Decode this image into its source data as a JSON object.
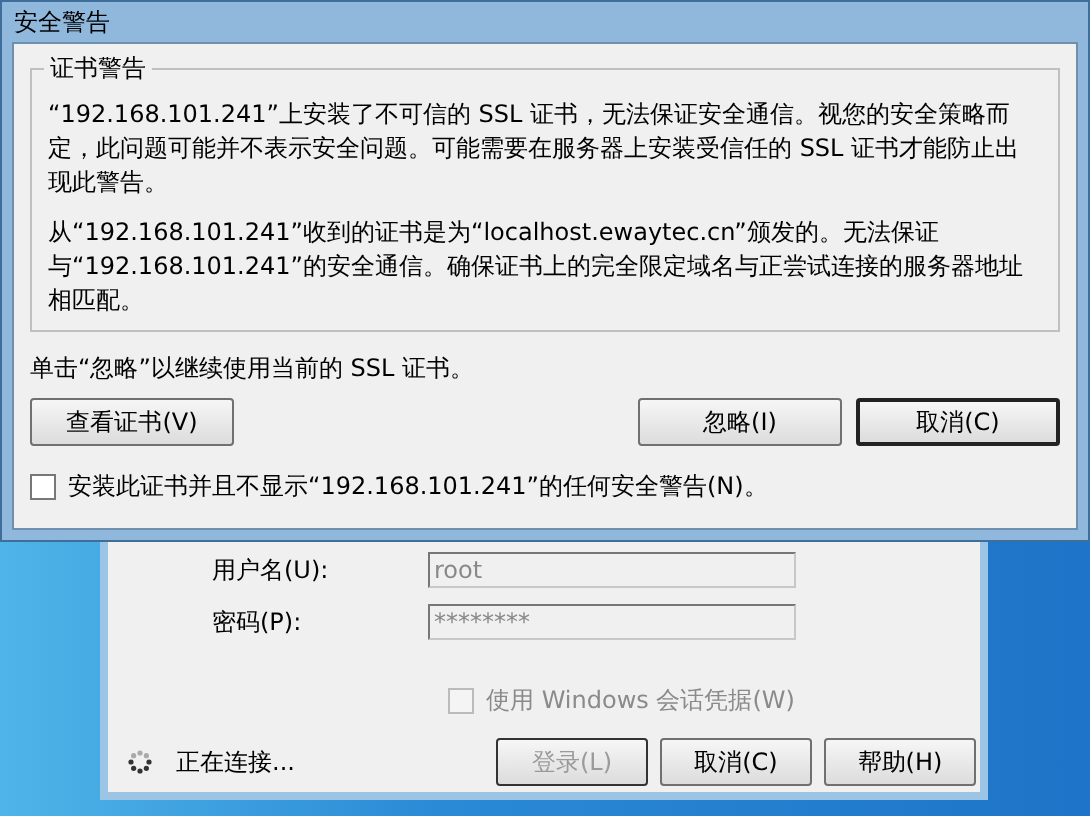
{
  "dialog": {
    "title": "安全警告",
    "group_title": "证书警告",
    "paragraphs": [
      "“192.168.101.241”上安装了不可信的 SSL 证书，无法保证安全通信。视您的安全策略而定，此问题可能并不表示安全问题。可能需要在服务器上安装受信任的 SSL 证书才能防止出现此警告。",
      "从“192.168.101.241”收到的证书是为“localhost.ewaytec.cn”颁发的。无法保证与“192.168.101.241”的安全通信。确保证书上的完全限定域名与正尝试连接的服务器地址相匹配。"
    ],
    "hint": "单击“忽略”以继续使用当前的 SSL 证书。",
    "buttons": [
      {
        "label": "查看证书(V)",
        "default": false
      },
      {
        "label": "忽略(I)",
        "default": false
      },
      {
        "label": "取消(C)",
        "default": true
      }
    ],
    "checkbox": {
      "label": "安装此证书并且不显示“192.168.101.241”的任何安全警告(N)。",
      "checked": false
    }
  },
  "login": {
    "fields": [
      {
        "label": "用户名(U):",
        "value": "root"
      },
      {
        "label": "密码(P):",
        "value": "********"
      }
    ],
    "checkbox": {
      "label": "使用 Windows 会话凭据(W)",
      "checked": false,
      "disabled": true
    },
    "status": "正在连接...",
    "buttons": [
      {
        "label": "登录(L)",
        "disabled": true
      },
      {
        "label": "取消(C)",
        "disabled": false
      },
      {
        "label": "帮助(H)",
        "disabled": false
      }
    ]
  }
}
